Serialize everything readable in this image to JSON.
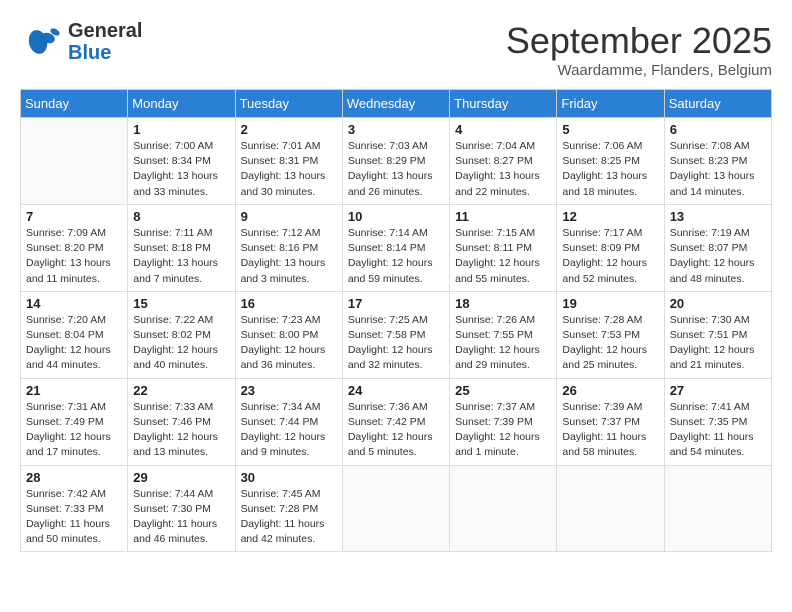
{
  "header": {
    "logo_general": "General",
    "logo_blue": "Blue",
    "month_title": "September 2025",
    "location": "Waardamme, Flanders, Belgium"
  },
  "days_of_week": [
    "Sunday",
    "Monday",
    "Tuesday",
    "Wednesday",
    "Thursday",
    "Friday",
    "Saturday"
  ],
  "weeks": [
    [
      {
        "day": "",
        "info": ""
      },
      {
        "day": "1",
        "info": "Sunrise: 7:00 AM\nSunset: 8:34 PM\nDaylight: 13 hours\nand 33 minutes."
      },
      {
        "day": "2",
        "info": "Sunrise: 7:01 AM\nSunset: 8:31 PM\nDaylight: 13 hours\nand 30 minutes."
      },
      {
        "day": "3",
        "info": "Sunrise: 7:03 AM\nSunset: 8:29 PM\nDaylight: 13 hours\nand 26 minutes."
      },
      {
        "day": "4",
        "info": "Sunrise: 7:04 AM\nSunset: 8:27 PM\nDaylight: 13 hours\nand 22 minutes."
      },
      {
        "day": "5",
        "info": "Sunrise: 7:06 AM\nSunset: 8:25 PM\nDaylight: 13 hours\nand 18 minutes."
      },
      {
        "day": "6",
        "info": "Sunrise: 7:08 AM\nSunset: 8:23 PM\nDaylight: 13 hours\nand 14 minutes."
      }
    ],
    [
      {
        "day": "7",
        "info": "Sunrise: 7:09 AM\nSunset: 8:20 PM\nDaylight: 13 hours\nand 11 minutes."
      },
      {
        "day": "8",
        "info": "Sunrise: 7:11 AM\nSunset: 8:18 PM\nDaylight: 13 hours\nand 7 minutes."
      },
      {
        "day": "9",
        "info": "Sunrise: 7:12 AM\nSunset: 8:16 PM\nDaylight: 13 hours\nand 3 minutes."
      },
      {
        "day": "10",
        "info": "Sunrise: 7:14 AM\nSunset: 8:14 PM\nDaylight: 12 hours\nand 59 minutes."
      },
      {
        "day": "11",
        "info": "Sunrise: 7:15 AM\nSunset: 8:11 PM\nDaylight: 12 hours\nand 55 minutes."
      },
      {
        "day": "12",
        "info": "Sunrise: 7:17 AM\nSunset: 8:09 PM\nDaylight: 12 hours\nand 52 minutes."
      },
      {
        "day": "13",
        "info": "Sunrise: 7:19 AM\nSunset: 8:07 PM\nDaylight: 12 hours\nand 48 minutes."
      }
    ],
    [
      {
        "day": "14",
        "info": "Sunrise: 7:20 AM\nSunset: 8:04 PM\nDaylight: 12 hours\nand 44 minutes."
      },
      {
        "day": "15",
        "info": "Sunrise: 7:22 AM\nSunset: 8:02 PM\nDaylight: 12 hours\nand 40 minutes."
      },
      {
        "day": "16",
        "info": "Sunrise: 7:23 AM\nSunset: 8:00 PM\nDaylight: 12 hours\nand 36 minutes."
      },
      {
        "day": "17",
        "info": "Sunrise: 7:25 AM\nSunset: 7:58 PM\nDaylight: 12 hours\nand 32 minutes."
      },
      {
        "day": "18",
        "info": "Sunrise: 7:26 AM\nSunset: 7:55 PM\nDaylight: 12 hours\nand 29 minutes."
      },
      {
        "day": "19",
        "info": "Sunrise: 7:28 AM\nSunset: 7:53 PM\nDaylight: 12 hours\nand 25 minutes."
      },
      {
        "day": "20",
        "info": "Sunrise: 7:30 AM\nSunset: 7:51 PM\nDaylight: 12 hours\nand 21 minutes."
      }
    ],
    [
      {
        "day": "21",
        "info": "Sunrise: 7:31 AM\nSunset: 7:49 PM\nDaylight: 12 hours\nand 17 minutes."
      },
      {
        "day": "22",
        "info": "Sunrise: 7:33 AM\nSunset: 7:46 PM\nDaylight: 12 hours\nand 13 minutes."
      },
      {
        "day": "23",
        "info": "Sunrise: 7:34 AM\nSunset: 7:44 PM\nDaylight: 12 hours\nand 9 minutes."
      },
      {
        "day": "24",
        "info": "Sunrise: 7:36 AM\nSunset: 7:42 PM\nDaylight: 12 hours\nand 5 minutes."
      },
      {
        "day": "25",
        "info": "Sunrise: 7:37 AM\nSunset: 7:39 PM\nDaylight: 12 hours\nand 1 minute."
      },
      {
        "day": "26",
        "info": "Sunrise: 7:39 AM\nSunset: 7:37 PM\nDaylight: 11 hours\nand 58 minutes."
      },
      {
        "day": "27",
        "info": "Sunrise: 7:41 AM\nSunset: 7:35 PM\nDaylight: 11 hours\nand 54 minutes."
      }
    ],
    [
      {
        "day": "28",
        "info": "Sunrise: 7:42 AM\nSunset: 7:33 PM\nDaylight: 11 hours\nand 50 minutes."
      },
      {
        "day": "29",
        "info": "Sunrise: 7:44 AM\nSunset: 7:30 PM\nDaylight: 11 hours\nand 46 minutes."
      },
      {
        "day": "30",
        "info": "Sunrise: 7:45 AM\nSunset: 7:28 PM\nDaylight: 11 hours\nand 42 minutes."
      },
      {
        "day": "",
        "info": ""
      },
      {
        "day": "",
        "info": ""
      },
      {
        "day": "",
        "info": ""
      },
      {
        "day": "",
        "info": ""
      }
    ]
  ]
}
